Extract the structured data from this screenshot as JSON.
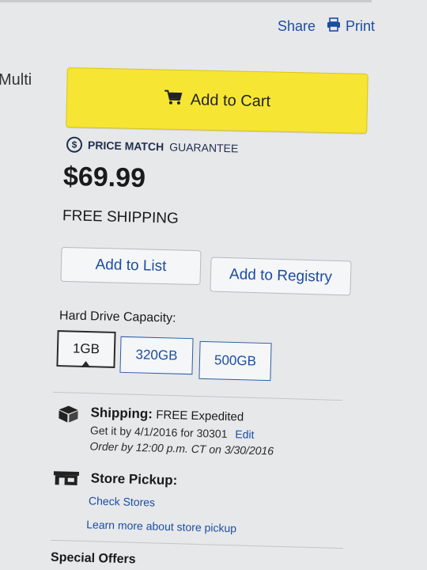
{
  "header": {
    "share_label": "Share",
    "print_label": "Print",
    "side_text": "Multi"
  },
  "cart": {
    "label": "Add to Cart",
    "icon": "cart-icon"
  },
  "price_match": {
    "badge": "$",
    "bold": "PRICE MATCH",
    "rest": "GUARANTEE"
  },
  "price": "$69.99",
  "free_shipping": "FREE SHIPPING",
  "actions": {
    "add_to_list": "Add to List",
    "add_to_registry": "Add to Registry"
  },
  "capacity": {
    "label": "Hard Drive Capacity:",
    "options": [
      "1GB",
      "320GB",
      "500GB"
    ],
    "selected": "1GB"
  },
  "shipping": {
    "title": "Shipping:",
    "value": "FREE Expedited",
    "get_it_by": "Get it by 4/1/2016 for 30301",
    "edit": "Edit",
    "order_by": "Order by 12:00 p.m. CT on 3/30/2016",
    "icon": "box-icon"
  },
  "pickup": {
    "title": "Store Pickup:",
    "check_stores": "Check Stores",
    "learn_more": "Learn more about store pickup",
    "icon": "store-icon"
  },
  "special_offers": "Special Offers",
  "colors": {
    "accent_blue": "#1b4da3",
    "cart_yellow": "#f7e534",
    "background": "#e7e8ea"
  }
}
